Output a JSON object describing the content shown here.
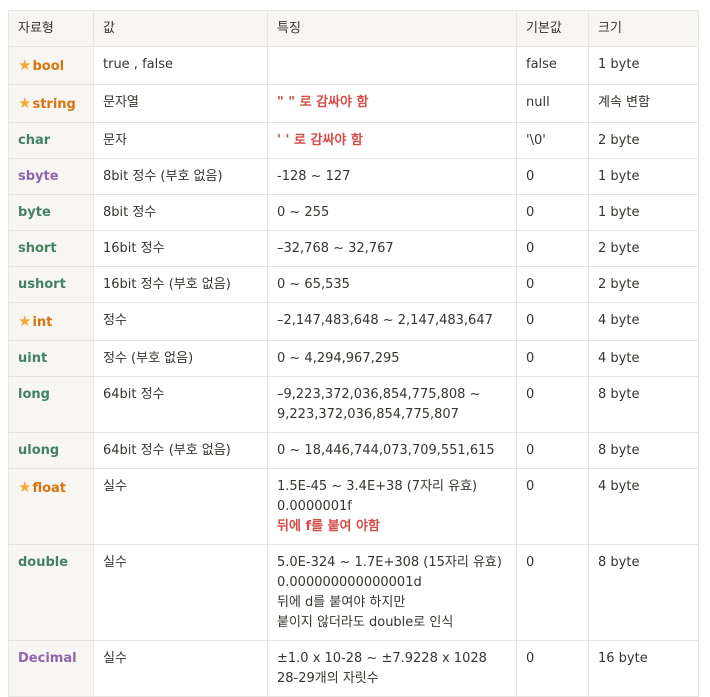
{
  "headers": [
    "자료형",
    "값",
    "특징",
    "기본값",
    "크기"
  ],
  "colors": {
    "orange": "#d9730d",
    "green": "#448361",
    "purple": "#9065b0",
    "red": "#d44c47",
    "star": "#f4a832"
  },
  "rows": [
    {
      "name": "bool",
      "starred": true,
      "value": "true , false",
      "feature": "",
      "default": "false",
      "size": "1 byte"
    },
    {
      "name": "string",
      "starred": true,
      "value": "문자열",
      "feature": "\" \" 로 감싸야 함",
      "default": "null",
      "size": "계속 변함"
    },
    {
      "name": "char",
      "starred": false,
      "value": "문자",
      "feature": "' ' 로 감싸야 함",
      "default": "'\\0'",
      "size": "2 byte"
    },
    {
      "name": "sbyte",
      "starred": false,
      "value": "8bit 정수  (부호 없음)",
      "feature": "-128 ~ 127",
      "default": "0",
      "size": "1 byte"
    },
    {
      "name": "byte",
      "starred": false,
      "value": "8bit 정수",
      "feature": "0 ~ 255",
      "default": "0",
      "size": "1 byte"
    },
    {
      "name": "short",
      "starred": false,
      "value": "16bit 정수",
      "feature": "–32,768 ~ 32,767",
      "default": "0",
      "size": "2 byte"
    },
    {
      "name": "ushort",
      "starred": false,
      "value": "16bit 정수  (부호 없음)",
      "feature": "0 ~ 65,535",
      "default": "0",
      "size": "2 byte"
    },
    {
      "name": "int",
      "starred": true,
      "value": "정수",
      "feature": "–2,147,483,648 ~ 2,147,483,647",
      "default": "0",
      "size": "4 byte"
    },
    {
      "name": "uint",
      "starred": false,
      "value": "정수 (부호 없음)",
      "feature": "0 ~ 4,294,967,295",
      "default": "0",
      "size": "4 byte"
    },
    {
      "name": "long",
      "starred": false,
      "value": "64bit 정수",
      "feature_line1": "–9,223,372,036,854,775,808 ~",
      "feature_line2": "9,223,372,036,854,775,807",
      "default": "0",
      "size": "8 byte"
    },
    {
      "name": "ulong",
      "starred": false,
      "value": "64bit 정수 (부호 없음)",
      "feature": "0 ~ 18,446,744,073,709,551,615",
      "default": "0",
      "size": "8 byte"
    },
    {
      "name": "float",
      "starred": true,
      "value": "실수",
      "feature_line1": "1.5E-45 ~ 3.4E+38 (7자리 유효)",
      "feature_line2": "0.0000001f",
      "feature_line3": "뒤에 f를 붙여 야함",
      "default": "0",
      "size": "4 byte"
    },
    {
      "name": "double",
      "starred": false,
      "value": "실수",
      "feature_line1": "5.0E-324 ~ 1.7E+308 (15자리 유효)",
      "feature_line2": "0.000000000000001d",
      "feature_line3": "뒤에 d를 붙여야 하지만",
      "feature_line4": "붙이지 않더라도 double로 인식",
      "default": "0",
      "size": "8 byte"
    },
    {
      "name": "Decimal",
      "starred": false,
      "value": "실수",
      "feature_line1": "±1.0 x 10-28 ~ ±7.9228 x 1028",
      "feature_line2": "28-29개의 자릿수",
      "default": "0",
      "size": "16 byte"
    }
  ]
}
